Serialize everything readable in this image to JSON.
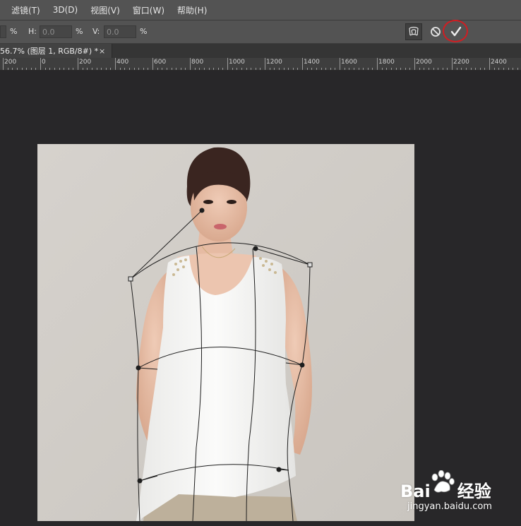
{
  "menu": {
    "items": [
      {
        "label": "滤镜(T)"
      },
      {
        "label": "3D(D)"
      },
      {
        "label": "视图(V)"
      },
      {
        "label": "窗口(W)"
      },
      {
        "label": "帮助(H)"
      }
    ]
  },
  "options_bar": {
    "w_unit": "%",
    "h_label": "H:",
    "h_value": "0.0",
    "h_unit": "%",
    "v_label": "V:",
    "v_value": "0.0",
    "v_unit": "%",
    "warp_icon": "warp-mode-icon",
    "cancel_icon": "cancel-transform-icon",
    "commit_icon": "commit-checkmark-icon",
    "highlight_color": "#d11d22"
  },
  "document_tab": {
    "title": "56.7% (图层 1, RGB/8#) *",
    "close_symbol": "×"
  },
  "ruler": {
    "labels": [
      "200",
      "0",
      "200",
      "400",
      "600",
      "800",
      "1000",
      "1200",
      "1400",
      "1600",
      "1800",
      "2000",
      "2200",
      "2400"
    ]
  },
  "canvas": {
    "content": "photo-woman-white-sleeveless-top",
    "background_color": "#cfcbc6"
  },
  "watermark": {
    "logo": "Bai",
    "logo2": "经验",
    "url": "jingyan.baidu.com"
  },
  "colors": {
    "app_bg": "#282729",
    "menu_bg": "#535353",
    "accent_red": "#d11d22"
  }
}
